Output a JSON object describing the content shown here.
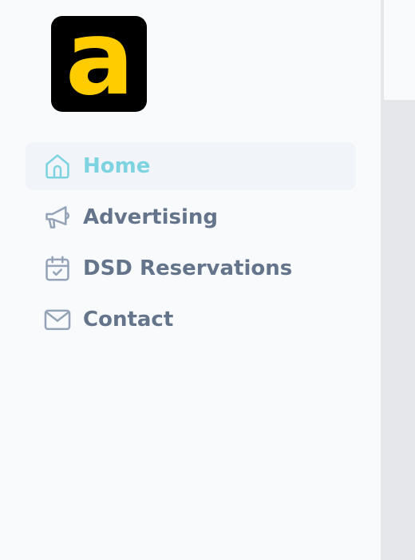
{
  "brand": {
    "logo_letter": "a",
    "logo_bg": "#000000",
    "logo_fg": "#ffcc00"
  },
  "colors": {
    "active": "#7dd3e0",
    "inactive": "#64748b",
    "icon_inactive": "#94a3b8"
  },
  "nav": {
    "items": [
      {
        "label": "Home",
        "icon": "home-icon",
        "active": true
      },
      {
        "label": "Advertising",
        "icon": "megaphone-icon",
        "active": false
      },
      {
        "label": "DSD Reservations",
        "icon": "calendar-check-icon",
        "active": false
      },
      {
        "label": "Contact",
        "icon": "mail-icon",
        "active": false
      }
    ]
  }
}
